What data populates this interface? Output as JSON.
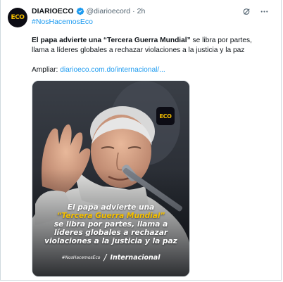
{
  "account": {
    "avatar_text": "ECO",
    "name": "DIARIOECO",
    "handle": "@diarioecord",
    "separator": "·",
    "time": "2h"
  },
  "hashtag_top": "#NosHacemosEco",
  "tweet": {
    "headline_bold": "El papa advierte una “Tercera Guerra Mundial”",
    "headline_rest": " se libra por partes, llama a líderes globales a rechazar violaciones a la justicia y la paz",
    "more_label": "Ampliar: ",
    "more_link": "diarioeco.com.do/internacional/..."
  },
  "media": {
    "badge_text": "ECO",
    "caption": {
      "line1": "El papa advierte una",
      "line2": "“Tercera Guerra Mundial”",
      "line3": "se libra por partes, llama a",
      "line4": "líderes globales a rechazar",
      "line5": "violaciones a la justicia y la paz"
    },
    "footer_tag": "#NosHacemosEco",
    "footer_slash": "/",
    "footer_section": "Internacional"
  },
  "icons": {
    "verified": "verified-badge-icon",
    "grok": "grok-icon",
    "more": "more-options-icon"
  },
  "colors": {
    "accent": "#1d9bf0",
    "brand_yellow": "#f5c000",
    "text": "#0f1419",
    "muted": "#536471"
  }
}
